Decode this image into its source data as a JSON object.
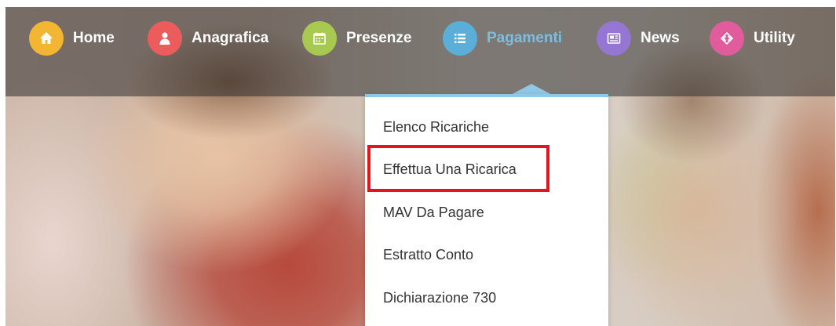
{
  "nav": {
    "items": [
      {
        "label": "Home",
        "icon": "home-icon",
        "color": "#f2b632",
        "active": false
      },
      {
        "label": "Anagrafica",
        "icon": "user-icon",
        "color": "#ec5c5c",
        "active": false
      },
      {
        "label": "Presenze",
        "icon": "calendar-icon",
        "color": "#a7c94f",
        "active": false
      },
      {
        "label": "Pagamenti",
        "icon": "list-icon",
        "color": "#5aaed8",
        "active": true
      },
      {
        "label": "News",
        "icon": "newspaper-icon",
        "color": "#9577d3",
        "active": false
      },
      {
        "label": "Utility",
        "icon": "diamond-arrows-icon",
        "color": "#e05c9c",
        "active": false
      }
    ],
    "active_label_color": "#79bfe2"
  },
  "dropdown": {
    "accent_color": "#8fc8e4",
    "items": [
      {
        "label": "Elenco Ricariche"
      },
      {
        "label": "Effettua Una Ricarica",
        "highlighted": true
      },
      {
        "label": "MAV Da Pagare"
      },
      {
        "label": "Estratto Conto"
      },
      {
        "label": "Dichiarazione 730"
      }
    ],
    "highlight_color": "#e2141c"
  }
}
